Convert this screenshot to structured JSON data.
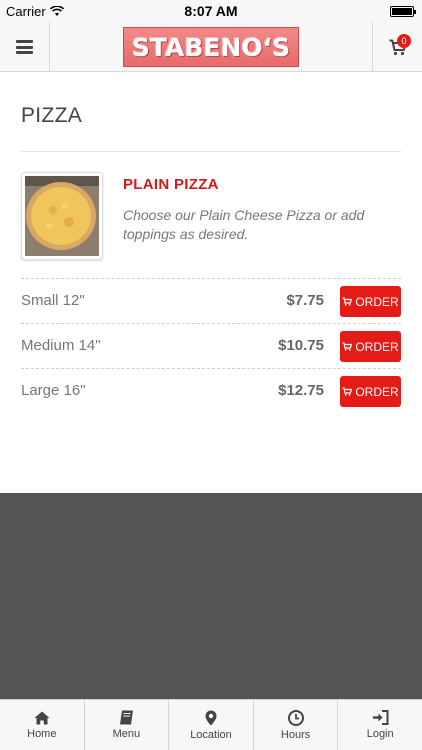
{
  "status_bar": {
    "carrier": "Carrier",
    "time": "8:07 AM"
  },
  "header": {
    "logo_text": "STABENO‘S",
    "cart_count": "0"
  },
  "section": {
    "title": "PIZZA"
  },
  "item": {
    "title": "PLAIN PIZZA",
    "description": "Choose our Plain Cheese Pizza or add toppings as desired.",
    "sizes": [
      {
        "name": "Small 12\"",
        "price": "$7.75",
        "order_label": "ORDER"
      },
      {
        "name": "Medium 14\"",
        "price": "$10.75",
        "order_label": "ORDER"
      },
      {
        "name": "Large 16\"",
        "price": "$12.75",
        "order_label": "ORDER"
      }
    ]
  },
  "tabs": [
    {
      "label": "Home",
      "icon": "home-icon"
    },
    {
      "label": "Menu",
      "icon": "book-icon"
    },
    {
      "label": "Location",
      "icon": "map-pin-icon"
    },
    {
      "label": "Hours",
      "icon": "clock-icon"
    },
    {
      "label": "Login",
      "icon": "login-icon"
    }
  ],
  "colors": {
    "accent": "#e41b17",
    "title_red": "#d4191b",
    "footer_grey": "#555555"
  }
}
